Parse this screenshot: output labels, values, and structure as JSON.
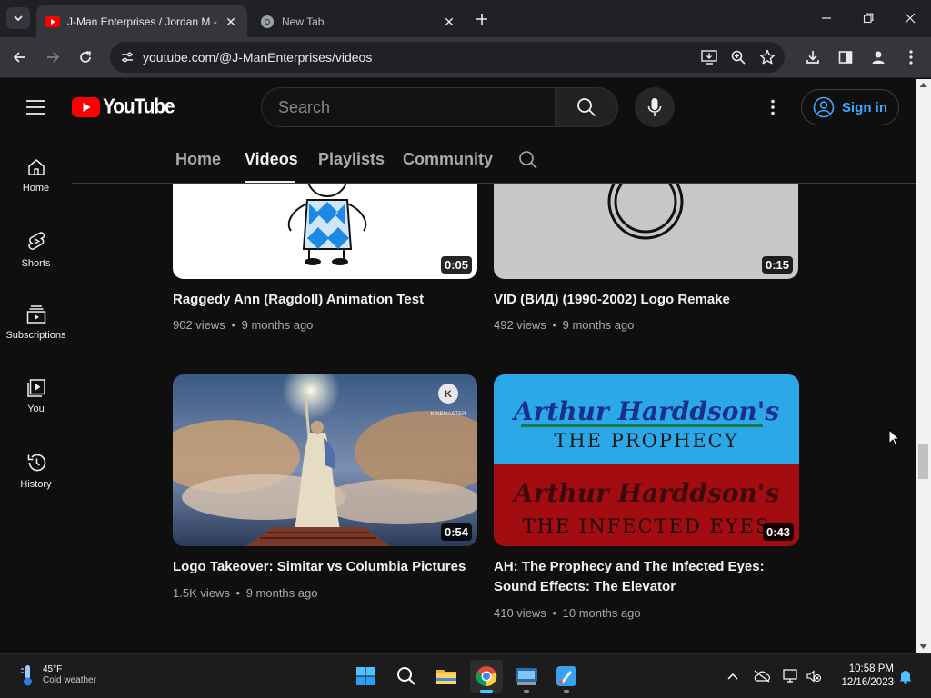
{
  "browser": {
    "tabs": [
      {
        "title": "J-Man Enterprises / Jordan M -",
        "active": true
      },
      {
        "title": "New Tab",
        "active": false
      }
    ],
    "url": "youtube.com/@J-ManEnterprises/videos"
  },
  "youtube": {
    "logo_text": "YouTube",
    "search_placeholder": "Search",
    "sign_in_label": "Sign in",
    "sidebar": [
      {
        "label": "Home",
        "icon": "home-icon"
      },
      {
        "label": "Shorts",
        "icon": "shorts-icon"
      },
      {
        "label": "Subscriptions",
        "icon": "subscriptions-icon"
      },
      {
        "label": "You",
        "icon": "you-icon"
      },
      {
        "label": "History",
        "icon": "history-icon"
      }
    ],
    "channel_tabs": [
      {
        "label": "Home",
        "active": false
      },
      {
        "label": "Videos",
        "active": true
      },
      {
        "label": "Playlists",
        "active": false
      },
      {
        "label": "Community",
        "active": false
      }
    ],
    "videos": [
      {
        "title": "Raggedy Ann (Ragdoll) Animation Test",
        "views": "902 views",
        "age": "9 months ago",
        "duration": "0:05"
      },
      {
        "title": "VID (ВИД) (1990-2002) Logo Remake",
        "views": "492 views",
        "age": "9 months ago",
        "duration": "0:15"
      },
      {
        "title": "Logo Takeover: Simitar vs Columbia Pictures",
        "views": "1.5K views",
        "age": "9 months ago",
        "duration": "0:54",
        "watermark": "KINEMASTER"
      },
      {
        "title": "AH: The Prophecy and The Infected Eyes: Sound Effects: The Elevator",
        "views": "410 views",
        "age": "10 months ago",
        "duration": "0:43",
        "thumb_text_top": "Arthur Harddson's",
        "thumb_text_top2": "THE PROPHECY",
        "thumb_text_bottom": "Arthur Harddson's",
        "thumb_text_bottom2": "THE INFECTED EYES"
      }
    ],
    "meta_separator": "•"
  },
  "taskbar": {
    "weather_temp": "45°F",
    "weather_desc": "Cold weather",
    "time": "10:58 PM",
    "date": "12/16/2023"
  },
  "colors": {
    "yt_red": "#ff0000",
    "link_blue": "#3ea6ff",
    "bg": "#0f0f0f"
  }
}
